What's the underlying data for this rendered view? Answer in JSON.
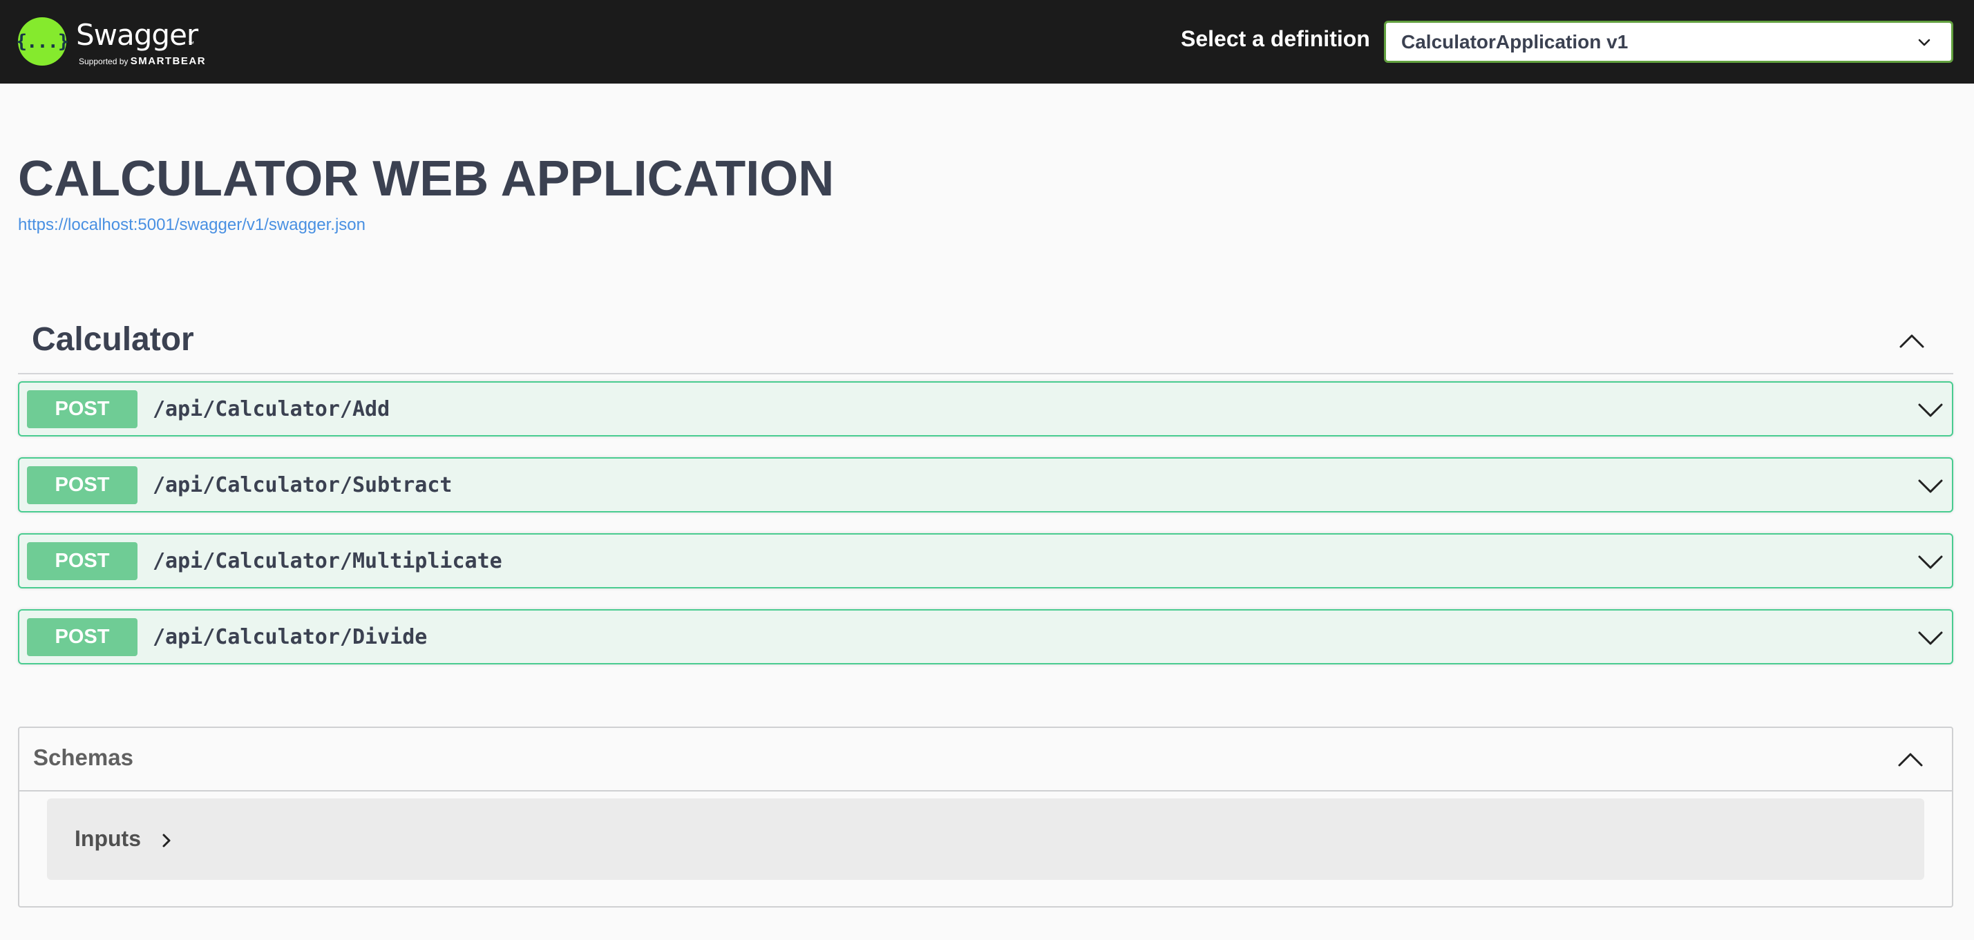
{
  "topbar": {
    "logo_glyph": "{...}",
    "logo_text": "Swagger",
    "logo_tm": "™",
    "logo_sub_prefix": "Supported by",
    "logo_sub_brand": "SMARTBEAR",
    "definition_label": "Select a definition",
    "definition_selected": "CalculatorApplication v1"
  },
  "info": {
    "title": "CALCULATOR WEB APPLICATION",
    "spec_url": "https://localhost:5001/swagger/v1/swagger.json"
  },
  "tag": {
    "name": "Calculator"
  },
  "operations": [
    {
      "method": "POST",
      "path": "/api/Calculator/Add"
    },
    {
      "method": "POST",
      "path": "/api/Calculator/Subtract"
    },
    {
      "method": "POST",
      "path": "/api/Calculator/Multiplicate"
    },
    {
      "method": "POST",
      "path": "/api/Calculator/Divide"
    }
  ],
  "schemas": {
    "title": "Schemas",
    "models": [
      {
        "name": "Inputs"
      }
    ]
  },
  "colors": {
    "topbar_bg": "#1b1b1b",
    "accent_green": "#85ea2d",
    "post_badge": "#6fcc95",
    "post_border": "#49cc90",
    "post_bg": "#ebf6f0",
    "link": "#4990e2"
  },
  "icons": {
    "logo": "swagger-logo-icon",
    "select_chevron": "chevron-down-icon",
    "tag_chevron": "chevron-up-icon",
    "op_chevron": "chevron-down-icon",
    "schemas_chevron": "chevron-up-icon",
    "model_chevron": "chevron-right-icon"
  }
}
